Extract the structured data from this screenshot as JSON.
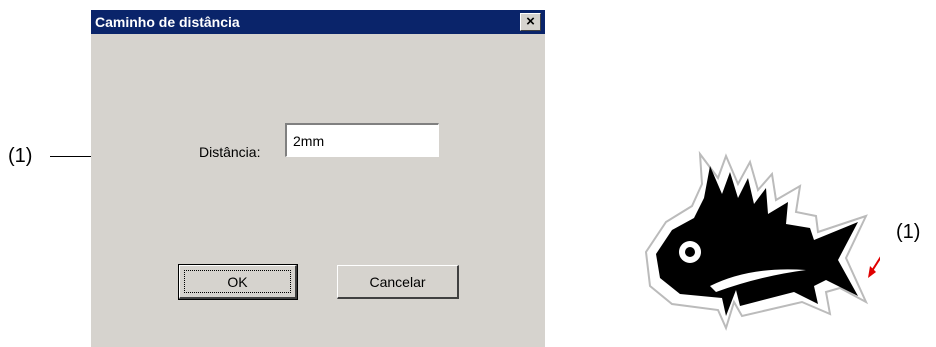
{
  "dialog": {
    "title": "Caminho de distância",
    "close_label": "×",
    "distance_label": "Distância:",
    "distance_value": "2mm",
    "ok_label": "OK",
    "cancel_label": "Cancelar"
  },
  "callouts": {
    "left": "(1)",
    "right": "(1)"
  },
  "colors": {
    "titlebar": "#0a246a",
    "dialog_bg": "#d6d3ce",
    "arrow": "#e00000"
  },
  "icons": {
    "close": "close-icon",
    "illustration": "fish-icon"
  }
}
